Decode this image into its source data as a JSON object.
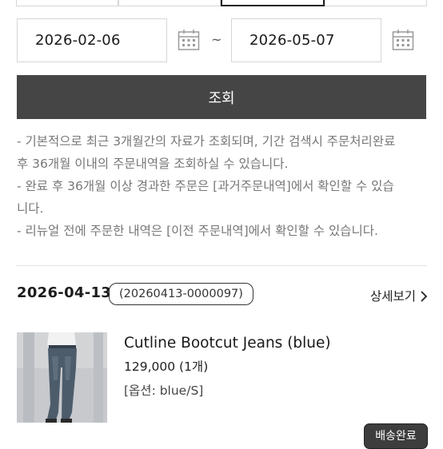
{
  "date_range": {
    "start": "2026-02-06",
    "end": "2026-05-07",
    "separator": "~",
    "calendar_icon": "calendar-icon"
  },
  "search": {
    "label": "조회"
  },
  "notes": [
    "- 기본적으로 최근 3개월간의 자료가 조회되며, 기간 검색시 주문처리완료",
    "후 36개월 이내의 주문내역을 조회하실 수 있습니다.",
    "- 완료 후 36개월 이상 경과한 주문은 [과거주문내역]에서 확인할 수 있습",
    "니다.",
    "- 리뉴얼 전에 주문한 내역은 [이전 주문내역]에서 확인할 수 있습니다."
  ],
  "order": {
    "date": "2026-04-13",
    "number": "(20260413-0000097)",
    "detail_label": "상세보기",
    "detail_icon": "chevron-right-icon",
    "item": {
      "name": "Cutline Bootcut Jeans (blue)",
      "price": "129,000 (1개)",
      "option": "[옵션: blue/S]",
      "image_icon": "product-photo-jeans"
    },
    "status": "배송완료"
  },
  "colors": {
    "search_button": "#454545",
    "status_badge": "#3d3d3d",
    "border": "#d6d6d6",
    "note_text": "#777777"
  }
}
